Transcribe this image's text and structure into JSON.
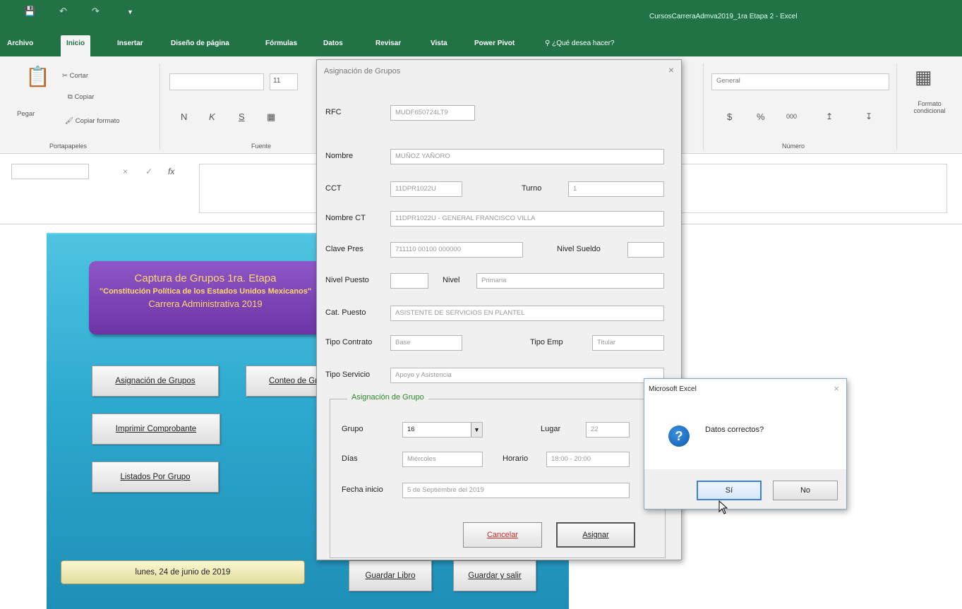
{
  "window": {
    "title": "CursosCarreraAdmva2019_1ra Etapa 2 - Excel"
  },
  "tabs": [
    "Archivo",
    "Inicio",
    "Insertar",
    "Diseño de página",
    "Fórmulas",
    "Datos",
    "Revisar",
    "Vista",
    "Power Pivot",
    "¿Qué desea hacer?"
  ],
  "ribbon": {
    "paste": "Pegar",
    "cut": "Cortar",
    "copy": "Copiar",
    "format_painter": "Copiar formato",
    "clipboard_group": "Portapapeles",
    "font_size": "11",
    "bold": "N",
    "italic": "K",
    "underline": "S",
    "font_group": "Fuente",
    "number_format": "General",
    "number_group": "Número",
    "currency": "$",
    "percent": "%",
    "thousands": "000",
    "cond_format": "Formato condicional"
  },
  "formula_bar": {
    "fx": "fx",
    "cancel": "×",
    "enter": "✓"
  },
  "sheet": {
    "banner": {
      "line1": "Captura de Grupos 1ra. Etapa",
      "line2": "\"Constitución Política de los Estados Unidos Mexicanos\"",
      "line3": "Carrera Administrativa 2019"
    },
    "buttons": {
      "asignacion": "Asignación de Grupos",
      "conteo": "Conteo de Grupos",
      "imprimir": "Imprimir Comprobante",
      "listados": "Listados Por Grupo",
      "guardar": "Guardar Libro",
      "guardar_salir": "Guardar y salir"
    },
    "date": "lunes, 24 de junio de 2019"
  },
  "dialog": {
    "title": "Asignación de Grupos",
    "close": "×",
    "labels": {
      "rfc": "RFC",
      "nombre": "Nombre",
      "cct": "CCT",
      "turno": "Turno",
      "nombre_ct": "Nombre CT",
      "clave_pres": "Clave Pres",
      "nivel_sueldo": "Nivel Sueldo",
      "nivel_puesto": "Nivel Puesto",
      "nivel": "Nivel",
      "cat_puesto": "Cat. Puesto",
      "tipo_contrato": "Tipo Contrato",
      "tipo_emp": "Tipo Emp",
      "tipo_servicio": "Tipo Servicio"
    },
    "values": {
      "rfc": "MUDF650724LT9",
      "nombre": "MUÑOZ                    YAÑORO",
      "cct": "11DPR1022U",
      "turno": "1",
      "nombre_ct": "11DPR1022U  -  GENERAL FRANCISCO VILLA",
      "clave_pres": "711110 00100 000000",
      "nivel_sueldo": "",
      "nivel_puesto": "",
      "nivel": "Primaria",
      "cat_puesto": "ASISTENTE DE SERVICIOS EN PLANTEL",
      "tipo_contrato": "Base",
      "tipo_emp": "Titular",
      "tipo_servicio": "Apoyo y Asistencia"
    },
    "group": {
      "legend": "Asignación de Grupo",
      "grupo_label": "Grupo",
      "grupo_value": "16",
      "lugar_label": "Lugar",
      "lugar_value": "22",
      "dias_label": "Días",
      "dias_value": "Miércoles",
      "horario_label": "Horario",
      "horario_value": "18:00 - 20:00",
      "fecha_label": "Fecha inicio",
      "fecha_value": "5 de Septiembre del 2019"
    },
    "cancel": "Cancelar",
    "assign": "Asignar"
  },
  "msgbox": {
    "title": "Microsoft Excel",
    "close": "×",
    "text": "Datos correctos?",
    "yes": "Sí",
    "no": "No"
  }
}
